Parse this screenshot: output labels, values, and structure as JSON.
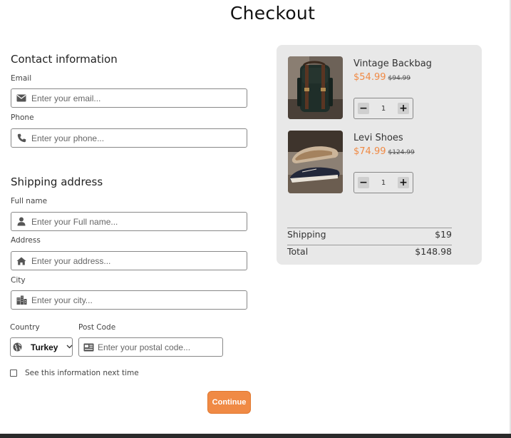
{
  "page": {
    "title": "Checkout"
  },
  "contact": {
    "heading": "Contact information",
    "email_label": "Email",
    "email_placeholder": "Enter your email...",
    "email_value": "",
    "phone_label": "Phone",
    "phone_placeholder": "Enter your phone...",
    "phone_value": ""
  },
  "shipping": {
    "heading": "Shipping address",
    "fullname_label": "Full name",
    "fullname_placeholder": "Enter your Full name...",
    "address_label": "Address",
    "address_placeholder": "Enter your address...",
    "city_label": "City",
    "city_placeholder": "Enter your city...",
    "country_label": "Country",
    "country_value": "Turkey",
    "postcode_label": "Post Code",
    "postcode_placeholder": "Enter your postal code...",
    "remember_label": "See this information next time",
    "remember_checked": false,
    "continue_label": "Continue"
  },
  "cart": {
    "items": [
      {
        "name": "Vintage Backbag",
        "price": "$54.99",
        "old_price": "$94.99",
        "quantity": "1",
        "image": "backpack-photo"
      },
      {
        "name": "Levi Shoes",
        "price": "$74.99",
        "old_price": "$124.99",
        "quantity": "1",
        "image": "shoes-photo"
      }
    ],
    "shipping_label": "Shipping",
    "shipping_value": "$19",
    "total_label": "Total",
    "total_value": "$148.98"
  },
  "icons": {
    "email": "envelope-icon",
    "phone": "phone-icon",
    "fullname": "user-icon",
    "address": "home-icon",
    "city": "city-icon",
    "country": "globe-icon",
    "postcode": "postal-card-icon",
    "minus": "minus-icon",
    "plus": "plus-icon"
  },
  "colors": {
    "accent": "#f08a45",
    "summary_bg": "#e8e8e8",
    "input_border": "#888888"
  }
}
